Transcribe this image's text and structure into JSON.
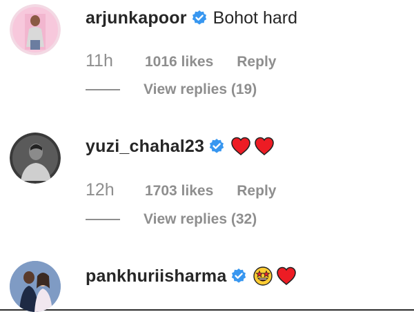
{
  "comments": [
    {
      "username": "arjunkapoor",
      "verified": true,
      "text": "Bohot hard",
      "emojis": [],
      "time": "11h",
      "likes": "1016 likes",
      "reply": "Reply",
      "view_replies": "View replies (19)"
    },
    {
      "username": "yuzi_chahal23",
      "verified": true,
      "text": "",
      "emojis": [
        "red-heart",
        "red-heart"
      ],
      "time": "12h",
      "likes": "1703 likes",
      "reply": "Reply",
      "view_replies": "View replies (32)"
    },
    {
      "username": "pankhuriisharma",
      "verified": true,
      "text": "",
      "emojis": [
        "star-struck",
        "red-heart"
      ]
    }
  ],
  "colors": {
    "text": "#262626",
    "secondary": "#8e8e8e",
    "verified": "#3897f0",
    "heart": "#ed1c24"
  }
}
